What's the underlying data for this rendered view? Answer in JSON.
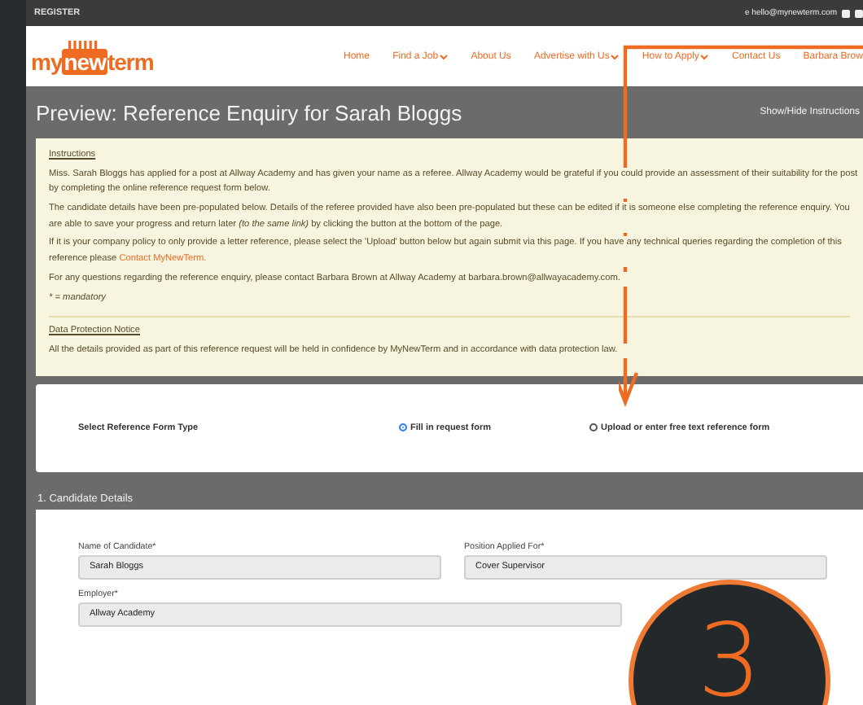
{
  "top_bar": {
    "register": "REGISTER",
    "email": "e hello@mynewterm.com"
  },
  "header": {
    "logo": {
      "prefix": "my",
      "highlight": "new",
      "suffix": "term"
    },
    "nav": [
      {
        "label": "Home",
        "has_dropdown": false
      },
      {
        "label": "Find a Job",
        "has_dropdown": true
      },
      {
        "label": "About Us",
        "has_dropdown": false
      },
      {
        "label": "Advertise with Us",
        "has_dropdown": true
      },
      {
        "label": "How to Apply",
        "has_dropdown": true
      },
      {
        "label": "Contact Us",
        "has_dropdown": false
      },
      {
        "label": "Barbara Brow",
        "has_dropdown": false
      }
    ]
  },
  "title": "Preview: Reference Enquiry for Sarah Bloggs",
  "show_hide": "Show/Hide Instructions",
  "instructions": {
    "heading": "Instructions",
    "paragraphs": [
      {
        "text": "Miss. Sarah Bloggs has applied for a post at Allway Academy and has given your name as a referee. Allway Academy would be grateful if you could provide an assessment of their suitability for the post by completing the online reference request form below."
      },
      {
        "text": "The candidate details have been pre-populated below. Details of the referee provided have also been pre-populated but these can be edited if it is someone else completing the reference enquiry. You are able to save your progress and return later *(to the same link)* by clicking the button at the bottom of the page."
      },
      {
        "text": "If it is your company policy to only provide a letter reference, please select the 'Upload' button below but again submit via this page. If you have any technical queries regarding the completion of this reference please",
        "link": "Contact MyNewTerm."
      },
      {
        "text": "For any questions regarding the reference enquiry, please contact Barbara Brown at Allway Academy at barbara.brown@allwayacademy.com."
      }
    ],
    "mandatory": "* = mandatory"
  },
  "data_protection": {
    "heading": "Data Protection Notice",
    "text": "All the details provided as part of this reference request will be held in confidence by MyNewTerm and in accordance with data protection law."
  },
  "form_type": {
    "label": "Select Reference Form Type",
    "options": [
      {
        "label": "Fill in request form",
        "selected": true
      },
      {
        "label": "Upload or enter free text reference form",
        "selected": false
      }
    ]
  },
  "candidate_details": {
    "title": "1. Candidate Details",
    "fields": [
      {
        "label": "Name of Candidate*",
        "value": "Sarah Bloggs",
        "kind": "half"
      },
      {
        "label": "Position Applied For*",
        "value": "Cover Supervisor",
        "kind": "half"
      },
      {
        "label": "Employer*",
        "value": "Allway Academy",
        "kind": "wide"
      }
    ]
  },
  "callout": {
    "number": "3"
  }
}
